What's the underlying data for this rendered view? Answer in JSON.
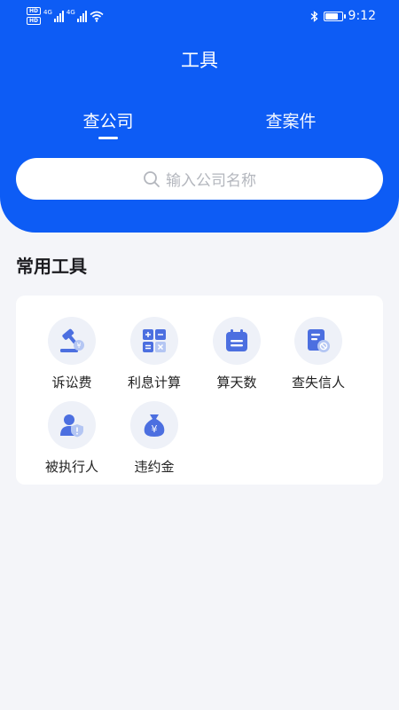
{
  "status_bar": {
    "network_badges": [
      "HD",
      "HD"
    ],
    "network_type_1": "4G",
    "network_type_2": "4G",
    "time": "9:12",
    "icons": [
      "wifi-icon",
      "bluetooth-icon",
      "battery-icon"
    ]
  },
  "header": {
    "title": "工具",
    "tabs": [
      {
        "label": "查公司",
        "active": true
      },
      {
        "label": "查案件",
        "active": false
      }
    ],
    "search": {
      "placeholder": "输入公司名称",
      "icon": "search-icon"
    },
    "background_color": "#0d5cf5"
  },
  "section": {
    "title": "常用工具",
    "tools": [
      {
        "label": "诉讼费",
        "icon": "gavel-yen-icon"
      },
      {
        "label": "利息计算",
        "icon": "calculator-icon"
      },
      {
        "label": "算天数",
        "icon": "calendar-icon"
      },
      {
        "label": "查失信人",
        "icon": "document-ban-icon"
      },
      {
        "label": "被执行人",
        "icon": "person-shield-icon"
      },
      {
        "label": "违约金",
        "icon": "money-bag-icon"
      }
    ]
  },
  "colors": {
    "accent": "#0d5cf5",
    "icon_blue": "#4c6fe0",
    "icon_light": "#b4c6f3",
    "background": "#f4f5f9"
  }
}
